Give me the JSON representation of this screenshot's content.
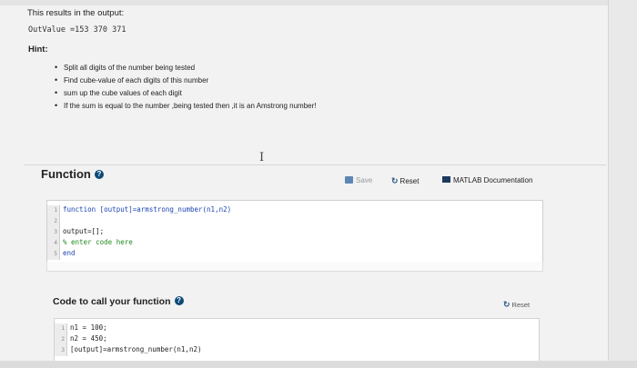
{
  "intro_text": "This results in the output:",
  "outvalue_line": "OutValue =153 370 371",
  "hint": {
    "title": "Hint:",
    "items": [
      "Split all digits of the number being tested",
      "Find cube-value of each digits of this number",
      "sum up the cube values of each digit",
      "If the sum is equal to the number ,being tested then ,it is an Amstrong number!"
    ]
  },
  "cursor_glyph": "I",
  "function_section": {
    "title": "Function",
    "info_glyph": "?",
    "save_label": "Save",
    "reset_label": "Reset",
    "matlab_doc_label": "MATLAB Documentation",
    "code_lines": [
      {
        "num": "1",
        "text": "function [output]=armstrong_number(n1,n2)"
      },
      {
        "num": "2",
        "text": ""
      },
      {
        "num": "3",
        "text": "output=[];"
      },
      {
        "num": "4",
        "text": "% enter code here"
      },
      {
        "num": "5",
        "text": "end"
      }
    ]
  },
  "call_section": {
    "title": "Code to call your function",
    "info_glyph": "?",
    "reset_label": "Reset",
    "code_lines": [
      {
        "num": "1",
        "text": "n1 = 100;"
      },
      {
        "num": "2",
        "text": "n2 = 450;"
      },
      {
        "num": "3",
        "text": "[output]=armstrong_number(n1,n2)"
      }
    ]
  },
  "icons": {
    "save": "save-icon",
    "reset": "reset-icon",
    "matlab": "matlab-icon",
    "info": "info-icon"
  },
  "colors": {
    "keyword": "#1c45b3",
    "comment": "#228b22",
    "info_icon": "#0c4a79"
  }
}
